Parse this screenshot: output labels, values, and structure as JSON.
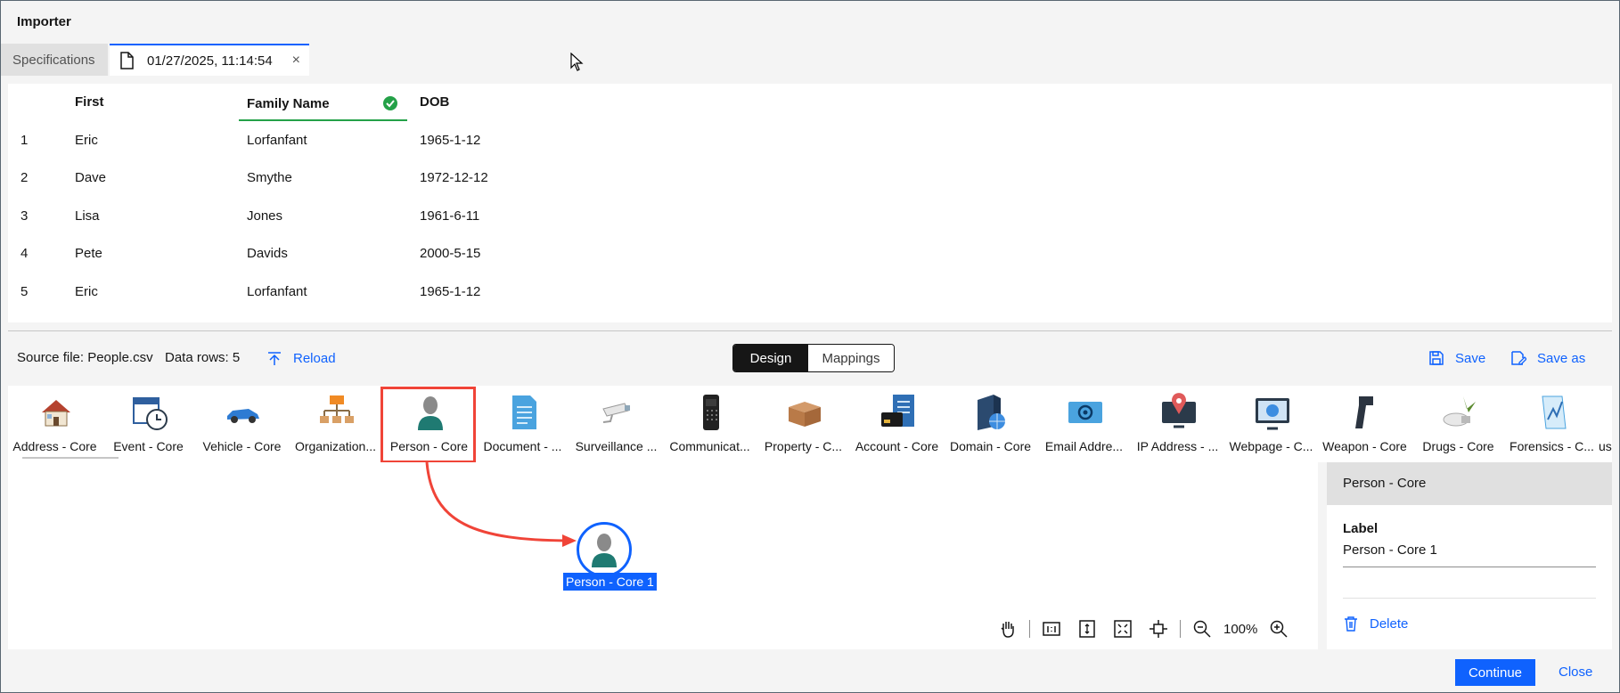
{
  "window": {
    "title": "Importer"
  },
  "tabs": {
    "specifications": "Specifications",
    "file_tab": "01/27/2025, 11:14:54",
    "close_glyph": "×"
  },
  "table": {
    "columns": [
      "First",
      "Family Name",
      "DOB"
    ],
    "rows": [
      {
        "n": "1",
        "first": "Eric",
        "family": "Lorfanfant",
        "dob": "1965-1-12"
      },
      {
        "n": "2",
        "first": "Dave",
        "family": "Smythe",
        "dob": "1972-12-12"
      },
      {
        "n": "3",
        "first": "Lisa",
        "family": "Jones",
        "dob": "1961-6-11"
      },
      {
        "n": "4",
        "first": "Pete",
        "family": "Davids",
        "dob": "2000-5-15"
      },
      {
        "n": "5",
        "first": "Eric",
        "family": "Lorfanfant",
        "dob": "1965-1-12"
      }
    ]
  },
  "toolbar": {
    "source_file": "Source file: People.csv",
    "data_rows": "Data rows: 5",
    "reload": "Reload",
    "design": "Design",
    "mappings": "Mappings",
    "save": "Save",
    "save_as": "Save as"
  },
  "palette": [
    {
      "label": "Address - Core",
      "icon": "house-icon"
    },
    {
      "label": "Event - Core",
      "icon": "calendar-clock-icon"
    },
    {
      "label": "Vehicle - Core",
      "icon": "car-icon"
    },
    {
      "label": "Organization...",
      "icon": "org-chart-icon"
    },
    {
      "label": "Person - Core",
      "icon": "person-icon"
    },
    {
      "label": "Document - ...",
      "icon": "document-icon"
    },
    {
      "label": "Surveillance ...",
      "icon": "cctv-camera-icon"
    },
    {
      "label": "Communicat...",
      "icon": "phone-icon"
    },
    {
      "label": "Property - C...",
      "icon": "box-icon"
    },
    {
      "label": "Account - Core",
      "icon": "account-card-icon"
    },
    {
      "label": "Domain - Core",
      "icon": "server-globe-icon"
    },
    {
      "label": "Email Addre...",
      "icon": "email-at-icon"
    },
    {
      "label": "IP Address - ...",
      "icon": "ip-monitor-pin-icon"
    },
    {
      "label": "Webpage - C...",
      "icon": "webpage-monitor-icon"
    },
    {
      "label": "Weapon - Core",
      "icon": "gun-icon"
    },
    {
      "label": "Drugs - Core",
      "icon": "drugs-icon"
    },
    {
      "label": "Forensics - C...",
      "icon": "forensics-chart-icon"
    },
    {
      "label": "us",
      "icon": ""
    }
  ],
  "canvas": {
    "node_label": "Person - Core 1",
    "zoom": "100%"
  },
  "properties": {
    "header": "Person - Core",
    "label_title": "Label",
    "label_value": "Person - Core 1",
    "delete": "Delete"
  },
  "footer": {
    "continue": "Continue",
    "close": "Close"
  }
}
